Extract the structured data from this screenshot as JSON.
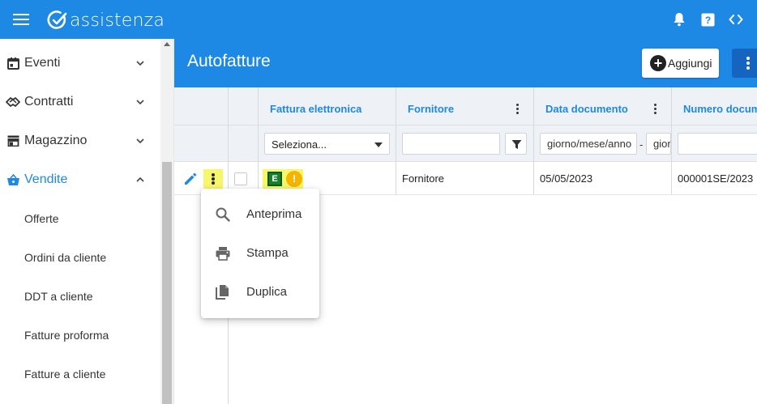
{
  "app": {
    "brand": "assistenza",
    "colors": {
      "primary": "#1e88e5",
      "highlight": "#f7f76a",
      "einvoice_badge": "#1a7f2a",
      "warning": "#f4b400"
    }
  },
  "topbar": {
    "icons": [
      "menu-icon",
      "bell-icon",
      "help-icon",
      "code-icon"
    ]
  },
  "sidebar": {
    "items": [
      {
        "label": "Eventi",
        "icon": "calendar-icon",
        "expanded": false
      },
      {
        "label": "Contratti",
        "icon": "handshake-icon",
        "expanded": false
      },
      {
        "label": "Magazzino",
        "icon": "store-icon",
        "expanded": false
      },
      {
        "label": "Vendite",
        "icon": "basket-icon",
        "expanded": true
      }
    ],
    "subitems": [
      "Offerte",
      "Ordini da cliente",
      "DDT a cliente",
      "Fatture proforma",
      "Fatture a cliente"
    ]
  },
  "page": {
    "title": "Autofatture",
    "add_label": "Aggiungi"
  },
  "grid": {
    "columns": [
      "Fattura elettronica",
      "Fornitore",
      "Data documento",
      "Numero documento"
    ],
    "filters": {
      "fattura_select": "Seleziona...",
      "fornitore": "",
      "data_from": "giorno/mese/anno",
      "data_to": "giorno/mese/anno",
      "numero": "",
      "range_sep": "-"
    },
    "rows": [
      {
        "einvoice_badge": "E",
        "warning_badge": "!",
        "fornitore": "Fornitore",
        "data": "05/05/2023",
        "numero": "000001SE/2023"
      }
    ]
  },
  "context_menu": {
    "items": [
      {
        "label": "Anteprima",
        "icon": "search-icon"
      },
      {
        "label": "Stampa",
        "icon": "print-icon"
      },
      {
        "label": "Duplica",
        "icon": "duplicate-icon"
      }
    ]
  }
}
